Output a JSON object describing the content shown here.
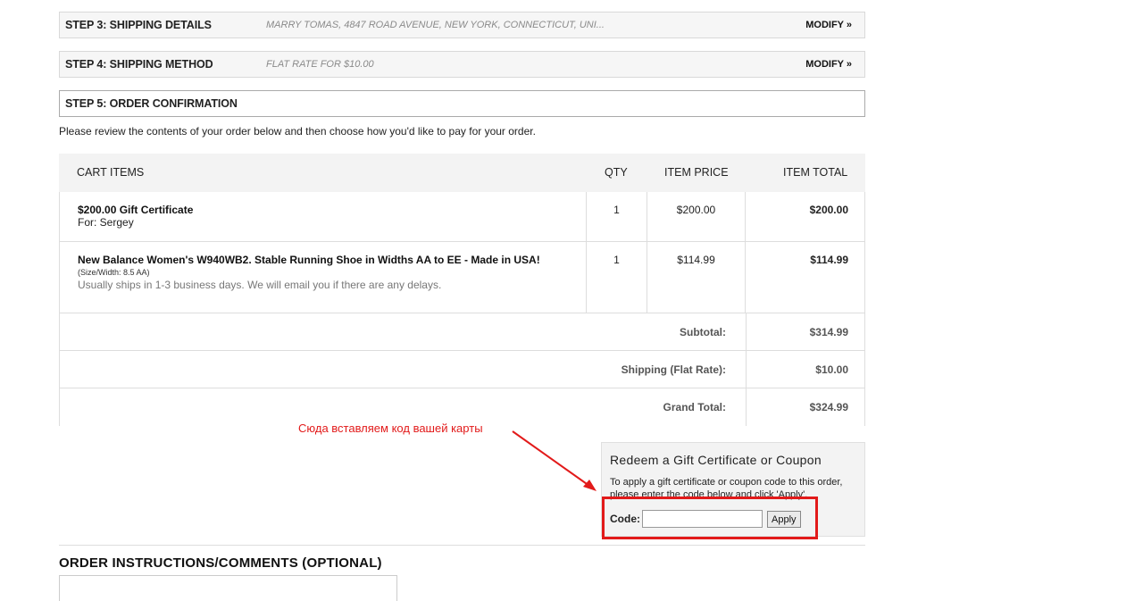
{
  "steps": {
    "step3": {
      "title": "STEP 3: SHIPPING DETAILS",
      "summary": "MARRY TOMAS, 4847 ROAD AVENUE, NEW YORK, CONNECTICUT, UNI...",
      "modify": "MODIFY »"
    },
    "step4": {
      "title": "STEP 4: SHIPPING METHOD",
      "summary": "FLAT RATE FOR $10.00",
      "modify": "MODIFY »"
    },
    "step5": {
      "title": "STEP 5: ORDER CONFIRMATION"
    }
  },
  "intro": "Please review the contents of your order below and then choose how you'd like to pay for your order.",
  "cart": {
    "headers": {
      "items": "CART ITEMS",
      "qty": "QTY",
      "price": "ITEM PRICE",
      "total": "ITEM TOTAL"
    },
    "rows": [
      {
        "name": "$200.00 Gift Certificate",
        "sub": "For: Sergey",
        "qty": "1",
        "price": "$200.00",
        "total": "$200.00"
      },
      {
        "name": "New Balance Women's W940WB2. Stable Running Shoe in Widths AA to EE - Made in USA!",
        "small": "(Size/Width: 8.5 AA)",
        "note": "Usually ships in 1-3 business days. We will email you if there are any delays.",
        "qty": "1",
        "price": "$114.99",
        "total": "$114.99"
      }
    ],
    "summary": [
      {
        "label": "Subtotal:",
        "value": "$314.99"
      },
      {
        "label": "Shipping (Flat Rate):",
        "value": "$10.00"
      },
      {
        "label": "Grand Total:",
        "value": "$324.99"
      }
    ]
  },
  "annotation": {
    "text": "Сюда вставляем код вашей карты",
    "color": "#e21a1a"
  },
  "coupon": {
    "title": "Redeem a Gift Certificate or Coupon",
    "desc": "To apply a gift certificate or coupon code to this order, please enter the code below and click 'Apply'.",
    "code_label": "Code:",
    "code_value": "",
    "apply_label": "Apply"
  },
  "comments": {
    "title": "ORDER INSTRUCTIONS/COMMENTS (OPTIONAL)",
    "value": ""
  }
}
